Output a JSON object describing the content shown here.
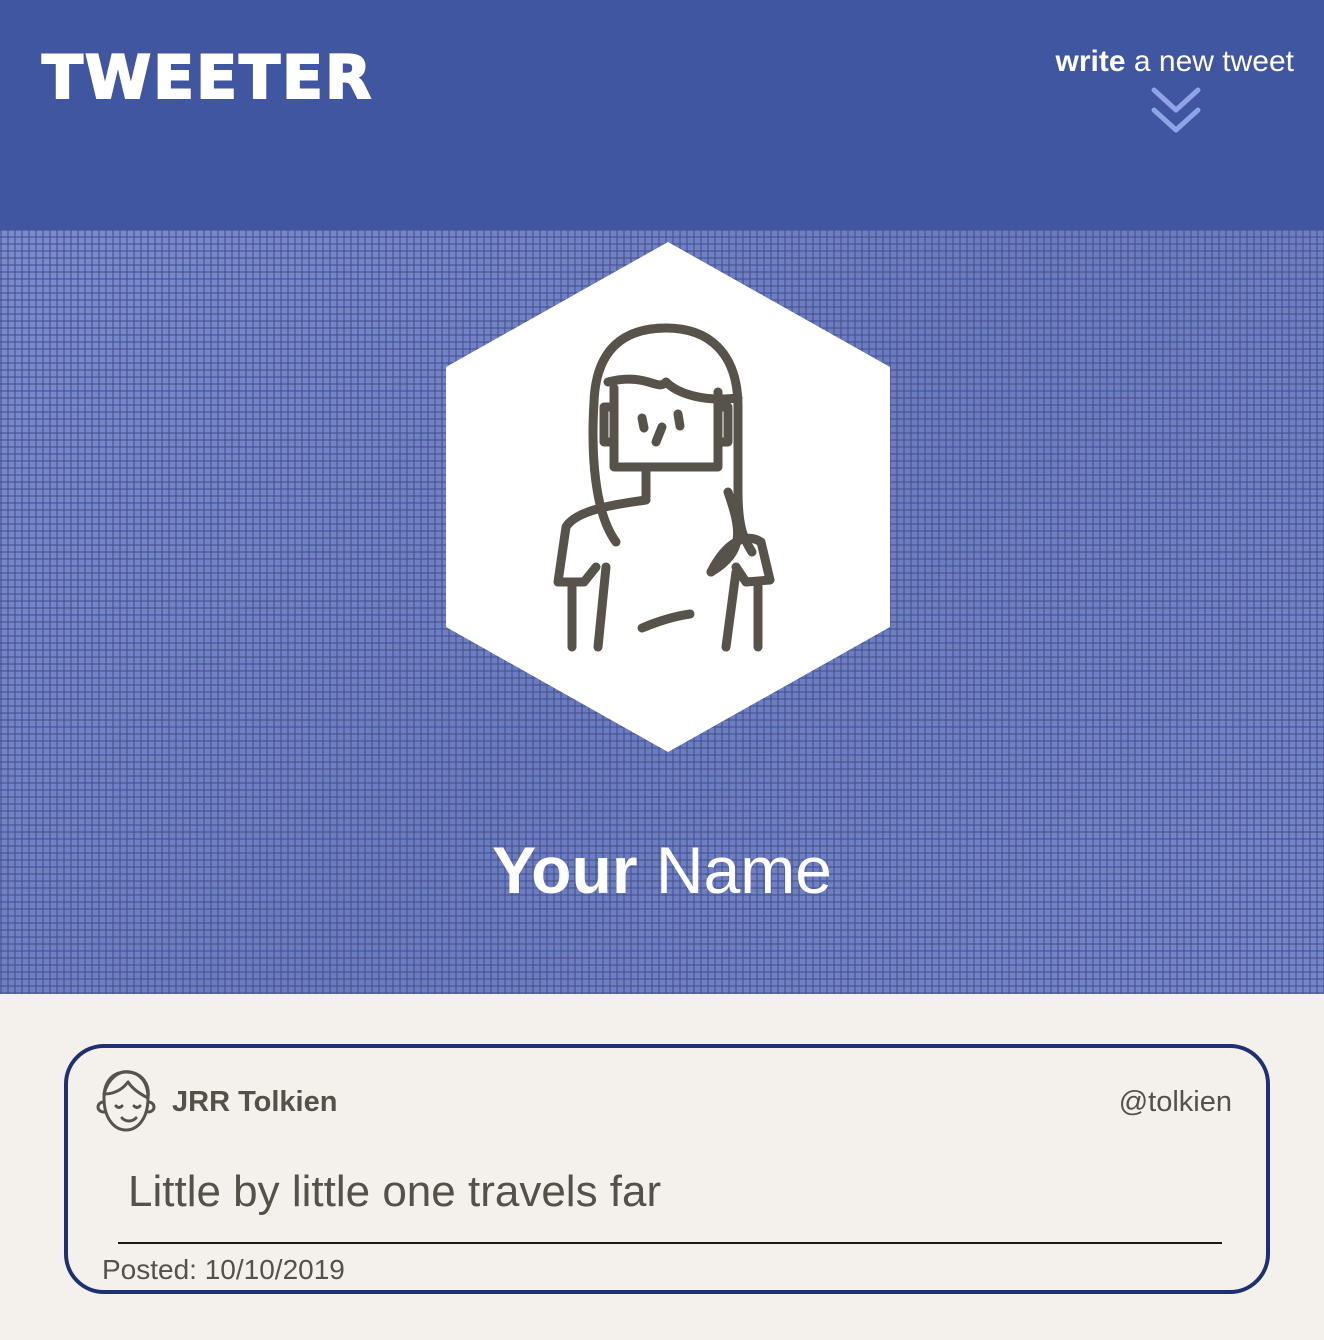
{
  "nav": {
    "logo": "TWEETER",
    "compose": {
      "bold": "write",
      "rest": "a new tweet"
    },
    "icon": "double-chevron-down-icon",
    "background": "#4056a1"
  },
  "profile": {
    "avatar_icon": "woman-avatar-icon",
    "name": {
      "first": "Your",
      "last": "Name"
    }
  },
  "tweets": [
    {
      "avatar_icon": "smiling-face-icon",
      "author": "JRR Tolkien",
      "handle": "@tolkien",
      "content": "Little by little one travels far",
      "posted": "Posted: 10/10/2019"
    }
  ],
  "colors": {
    "accent": "#4056a1",
    "card_border": "#1f3070",
    "page_background": "#f4f1ed",
    "text": "#545149"
  }
}
